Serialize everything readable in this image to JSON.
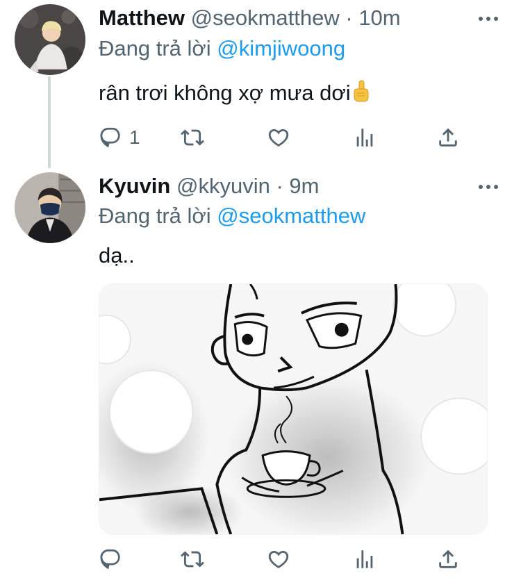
{
  "tweets": [
    {
      "display_name": "Matthew",
      "handle": "@seokmatthew",
      "separator": "·",
      "time": "10m",
      "replying_prefix": "Đang trả lời",
      "replying_to": "@kimjiwoong",
      "text": "rân trơi không xợ mưa dơi",
      "emoji": "pointing-up-hand",
      "reply_count": "1"
    },
    {
      "display_name": "Kyuvin",
      "handle": "@kkyuvin",
      "separator": "·",
      "time": "9m",
      "replying_prefix": "Đang trả lời",
      "replying_to": "@seokmatthew",
      "text": "dạ..",
      "media": "sketch-man-with-teacup",
      "reply_count": ""
    }
  ],
  "colors": {
    "text": "#0f1419",
    "secondary": "#536471",
    "link": "#1d9bf0",
    "thread_line": "#cfd9de"
  },
  "icons": [
    "reply-icon",
    "retweet-icon",
    "like-icon",
    "analytics-icon",
    "share-icon",
    "more-icon"
  ]
}
